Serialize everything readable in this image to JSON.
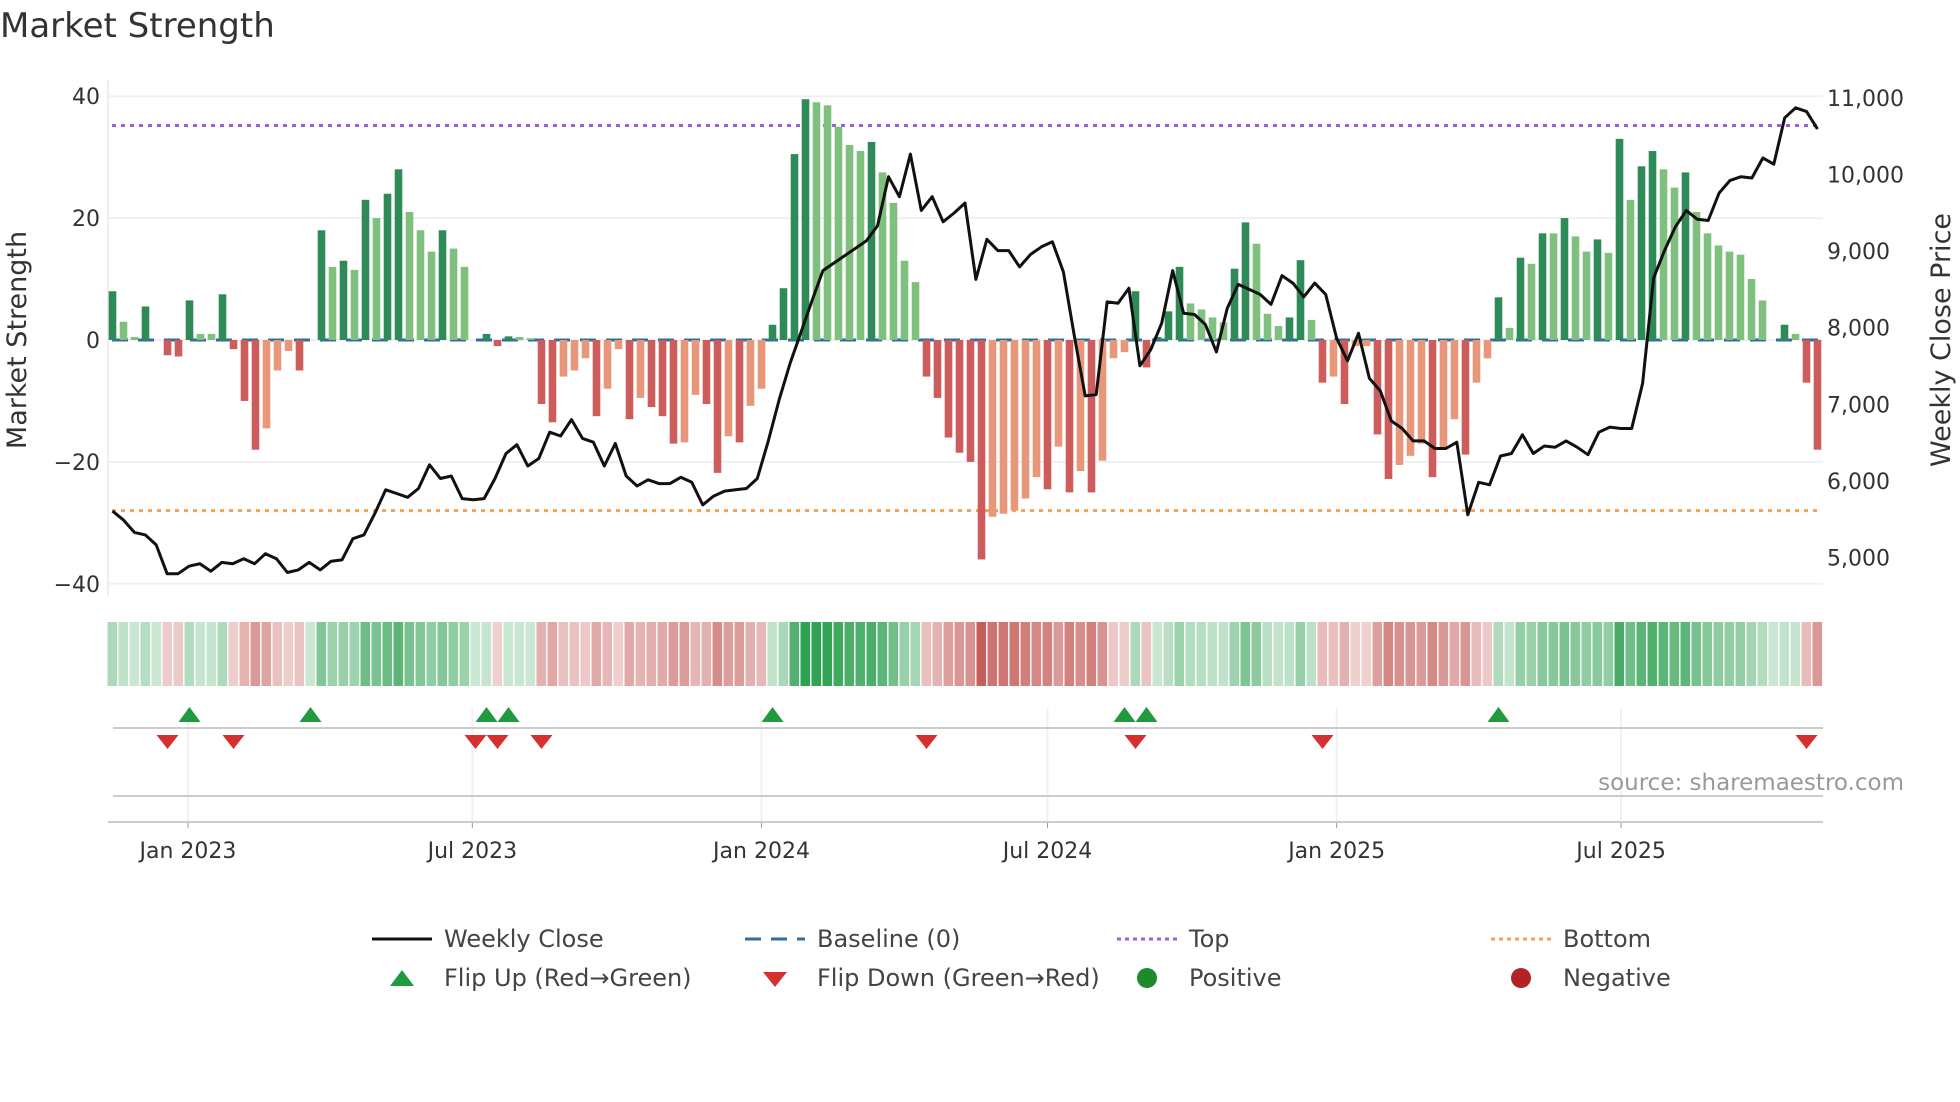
{
  "chart_data": {
    "type": "bar",
    "title": "Market Strength",
    "ylabel": "Market Strength",
    "y2label": "Weekly Close Price",
    "ylim": [
      -42,
      42
    ],
    "y2lim": [
      4500,
      11180
    ],
    "yticks": [
      40,
      20,
      0,
      -20,
      -40
    ],
    "yticklabels": [
      "40",
      "20",
      "0",
      "−20",
      "−40"
    ],
    "y2ticks": [
      11000,
      10000,
      9000,
      8000,
      7000,
      6000,
      5000
    ],
    "y2ticklabels": [
      "11,000",
      "10,000",
      "9,000",
      "8,000",
      "7,000",
      "6,000",
      "5,000"
    ],
    "start_date": "2022-11-14",
    "frequency": "weekly",
    "xticks": [
      {
        "date": "2023-01-01",
        "label": "Jan 2023"
      },
      {
        "date": "2023-07-01",
        "label": "Jul 2023"
      },
      {
        "date": "2024-01-01",
        "label": "Jan 2024"
      },
      {
        "date": "2024-07-01",
        "label": "Jul 2024"
      },
      {
        "date": "2025-01-01",
        "label": "Jan 2025"
      },
      {
        "date": "2025-07-01",
        "label": "Jul 2025"
      }
    ],
    "top_level": 35.2,
    "bottom_level": -28,
    "strength": [
      8,
      3,
      0.5,
      5.5,
      0,
      -2.5,
      -2.7,
      6.5,
      1,
      1,
      7.5,
      -1.5,
      -10,
      -18,
      -14.5,
      -5,
      -1.8,
      -5,
      0,
      18,
      12,
      13,
      11.5,
      23,
      20,
      24,
      28,
      21,
      18,
      14.5,
      18,
      15,
      12,
      0,
      1,
      -1,
      0.6,
      0.5,
      0.3,
      -10.5,
      -13.5,
      -6,
      -5,
      -3,
      -12.5,
      -8,
      -1.5,
      -13,
      -9.5,
      -11,
      -12.5,
      -17,
      -16.8,
      -9,
      -10.5,
      -21.8,
      -15.8,
      -16.8,
      -10.8,
      -8,
      2.5,
      8.5,
      30.5,
      39.5,
      39,
      38.5,
      35,
      32,
      31,
      32.5,
      27.5,
      22.5,
      13,
      9.5,
      -6,
      -9.5,
      -16,
      -18.5,
      -20,
      -36,
      -29,
      -28.5,
      -28,
      -26,
      -22.5,
      -24.5,
      -17.5,
      -25,
      -21.5,
      -25,
      -19.8,
      -3,
      -2,
      8,
      -4.5,
      0.5,
      4.7,
      12,
      6,
      5,
      3.7,
      2.9,
      11.7,
      19.3,
      15.8,
      4.3,
      2.3,
      3.7,
      13.1,
      3.3,
      -7,
      -6,
      -10.5,
      -1,
      -1,
      -15.5,
      -22.8,
      -20.5,
      -19,
      -17,
      -22.5,
      -18,
      -13,
      -18.8,
      -7,
      -3,
      7,
      2,
      13.5,
      12.5,
      17.5,
      17.5,
      20,
      17,
      14.5,
      16.5,
      14.3,
      33,
      23,
      28.5,
      31,
      28,
      25,
      27.5,
      21,
      17.5,
      15.5,
      14.5,
      14,
      10,
      6.5,
      0,
      2.5,
      1,
      -7,
      -18
    ],
    "weekly_close": [
      5608,
      5493,
      5330,
      5297,
      5167,
      4791,
      4791,
      4889,
      4922,
      4823,
      4938,
      4922,
      4987,
      4922,
      5052,
      4987,
      4807,
      4840,
      4938,
      4840,
      4954,
      4971,
      5248,
      5297,
      5575,
      5886,
      5837,
      5788,
      5902,
      6212,
      6033,
      6065,
      5771,
      5755,
      5771,
      6033,
      6359,
      6474,
      6196,
      6294,
      6637,
      6588,
      6801,
      6556,
      6506,
      6196,
      6490,
      6065,
      5935,
      6016,
      5967,
      5967,
      6049,
      5984,
      5689,
      5804,
      5869,
      5886,
      5902,
      6033,
      6523,
      7062,
      7536,
      7944,
      8353,
      8745,
      8843,
      8941,
      9039,
      9137,
      9333,
      9971,
      9709,
      10265,
      9529,
      9709,
      9382,
      9497,
      9627,
      8631,
      9154,
      9007,
      9007,
      8794,
      8957,
      9056,
      9121,
      8729,
      7895,
      7111,
      7127,
      8337,
      8320,
      8516,
      7503,
      7716,
      8059,
      8745,
      8190,
      8173,
      8042,
      7683,
      8255,
      8565,
      8500,
      8435,
      8304,
      8680,
      8582,
      8402,
      8582,
      8435,
      7863,
      7569,
      7928,
      7340,
      7176,
      6784,
      6686,
      6523,
      6523,
      6425,
      6425,
      6506,
      5559,
      5984,
      5951,
      6327,
      6359,
      6605,
      6359,
      6457,
      6441,
      6523,
      6441,
      6343,
      6637,
      6703,
      6686,
      6686,
      7274,
      8647,
      9007,
      9317,
      9529,
      9415,
      9399,
      9758,
      9922,
      9971,
      9954,
      10216,
      10134,
      10739,
      10869,
      10820,
      10591
    ],
    "flip_up_weeks": [
      7,
      18,
      34,
      36,
      60,
      92,
      94,
      126
    ],
    "flip_down_weeks": [
      5,
      11,
      33,
      35,
      39,
      74,
      93,
      110,
      154
    ],
    "legend": [
      {
        "key": "close",
        "label": "Weekly Close"
      },
      {
        "key": "baseline",
        "label": "Baseline (0)"
      },
      {
        "key": "top",
        "label": "Top"
      },
      {
        "key": "bottom",
        "label": "Bottom"
      },
      {
        "key": "flip_up",
        "label": "Flip Up (Red→Green)"
      },
      {
        "key": "flip_down",
        "label": "Flip Down (Green→Red)"
      },
      {
        "key": "positive",
        "label": "Positive"
      },
      {
        "key": "negative",
        "label": "Negative"
      }
    ],
    "legend_position": "bottom",
    "grid": true
  },
  "colors": {
    "pos_strong": "#2e8b57",
    "pos_weak": "#80c07e",
    "neg_strong": "#cd5c5c",
    "neg_weak": "#e9977a",
    "baseline": "#2f6f9f",
    "top": "#9b5fd6",
    "bottom": "#f0a35e",
    "close": "#111111",
    "flip_up": "#1f9a3e",
    "flip_down": "#d62f2f",
    "positive": "#1e8a2e",
    "negative": "#b22424"
  },
  "source": "source: sharemaestro.com"
}
